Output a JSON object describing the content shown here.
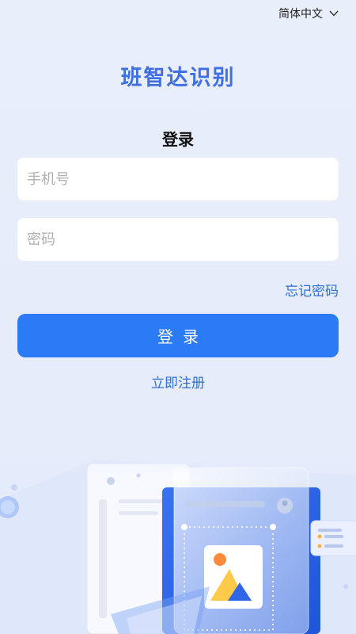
{
  "language_selector": {
    "label": "简体中文"
  },
  "app": {
    "title": "班智达识别"
  },
  "login": {
    "heading": "登录",
    "phone_placeholder": "手机号",
    "password_placeholder": "密码",
    "forgot_password": "忘记密码",
    "submit_label": "登录",
    "register_link": "立即注册"
  },
  "colors": {
    "accent": "#2c7bf6",
    "title": "#3f6fe0",
    "link": "#2d6fd3",
    "background": "#e9eefb"
  }
}
